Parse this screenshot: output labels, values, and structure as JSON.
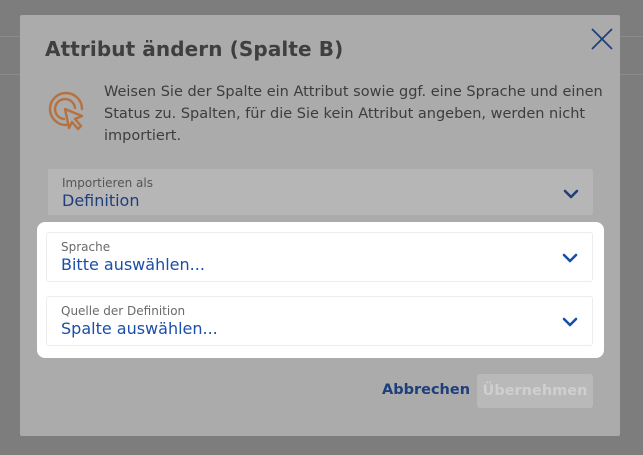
{
  "dialog": {
    "title": "Attribut ändern (Spalte B)",
    "info_text": "Weisen Sie der Spalte ein Attribut sowie ggf. eine Sprache und einen Status zu. Spalten, für die Sie kein Attribut angeben, werden nicht importiert.",
    "import_as": {
      "label": "Importieren als",
      "value": "Definition"
    },
    "language": {
      "label": "Sprache",
      "value": "Bitte auswählen..."
    },
    "source": {
      "label": "Quelle der Definition",
      "value": "Spalte auswählen..."
    },
    "cancel_label": "Abbrechen",
    "apply_label": "Übernehmen"
  },
  "colors": {
    "accent": "#1a4ea8",
    "icon_orange": "#b5713f"
  },
  "icons": [
    "close-icon",
    "cursor-click-icon",
    "chevron-down-icon"
  ]
}
